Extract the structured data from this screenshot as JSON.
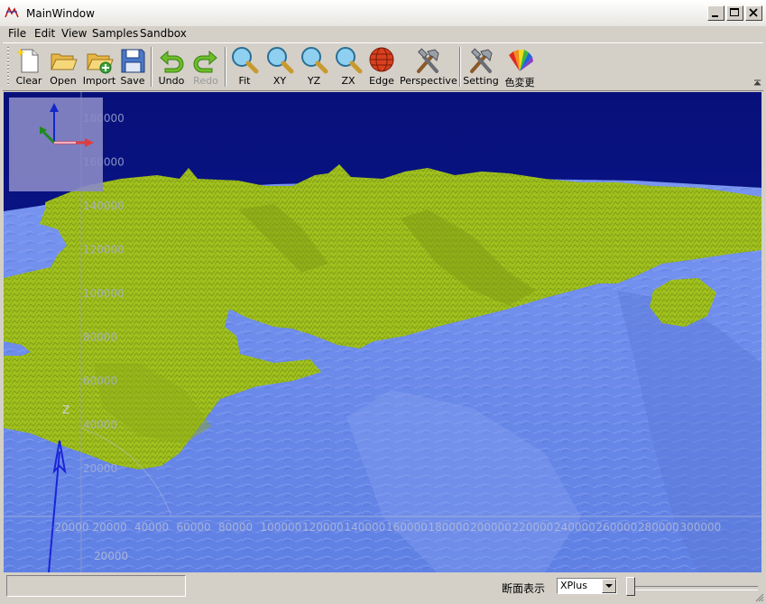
{
  "window": {
    "title": "MainWindow"
  },
  "menu": {
    "items": [
      "File",
      "Edit",
      "View",
      "Samples",
      "Sandbox"
    ]
  },
  "toolbar": {
    "clear": "Clear",
    "open": "Open",
    "import": "Import",
    "save": "Save",
    "undo": "Undo",
    "redo": "Redo",
    "fit": "Fit",
    "xy": "XY",
    "yz": "YZ",
    "zx": "ZX",
    "edge": "Edge",
    "perspective": "Perspective",
    "setting": "Setting",
    "color_change": "色変更"
  },
  "viewport": {
    "z_axis_label": "Z",
    "vertical_ticks": [
      "180000",
      "160000",
      "140000",
      "120000",
      "100000",
      "80000",
      "60000",
      "40000",
      "20000"
    ],
    "horizontal_ticks": [
      "-20000",
      "20000",
      "40000",
      "60000",
      "80000",
      "100000",
      "120000",
      "140000",
      "160000",
      "180000",
      "200000",
      "220000",
      "240000",
      "260000",
      "280000",
      "300000"
    ],
    "depth_tick": "20000",
    "colors": {
      "sky": "#0a148c",
      "sea": "#6e8ff0",
      "land": "#a0c01e"
    }
  },
  "status": {
    "message": "",
    "section_label": "断面表示",
    "section_value": "XPlus",
    "section_options": [
      "XPlus"
    ]
  }
}
